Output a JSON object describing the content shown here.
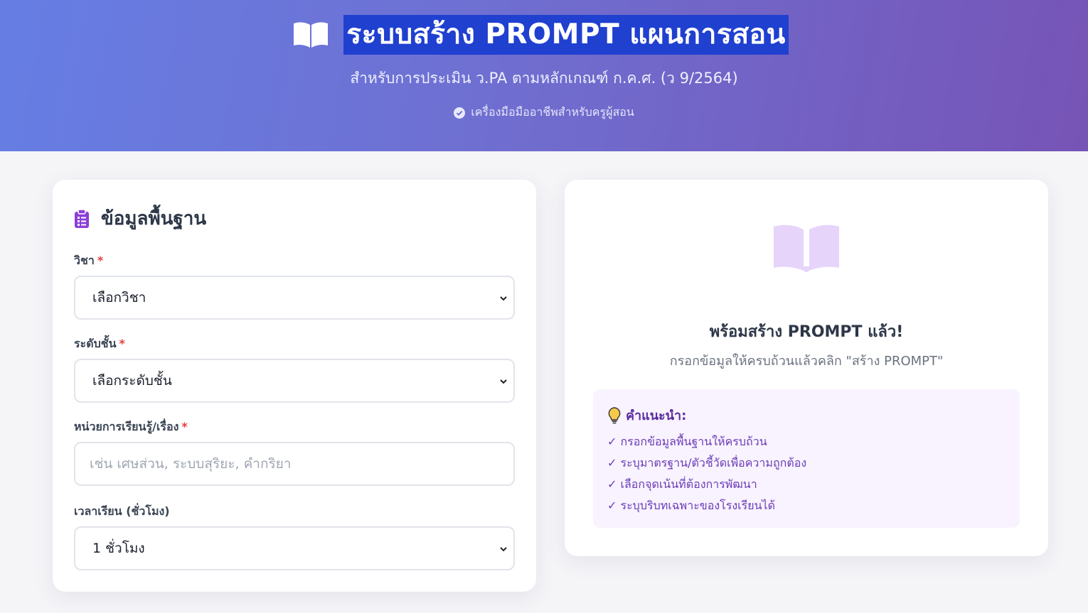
{
  "header": {
    "title": "ระบบสร้าง PROMPT แผนการสอน",
    "subtitle": "สำหรับการประเมิน ว.PA ตามหลักเกณฑ์ ก.ค.ศ. (ว 9/2564)",
    "tagline": "เครื่องมือมืออาชีพสำหรับครูผู้สอน",
    "colors": {
      "gradient_start": "#667ee4",
      "gradient_end": "#7654b6",
      "title_highlight": "#2040d0"
    }
  },
  "form": {
    "heading": "ข้อมูลพื้นฐาน",
    "fields": {
      "subject": {
        "label": "วิชา",
        "required_mark": "*",
        "value": "เลือกวิชา"
      },
      "grade": {
        "label": "ระดับชั้น",
        "required_mark": "*",
        "value": "เลือกระดับชั้น"
      },
      "unit": {
        "label": "หน่วยการเรียนรู้/เรื่อง",
        "required_mark": "*",
        "placeholder": "เช่น เศษส่วน, ระบบสุริยะ, คำกริยา"
      },
      "hours": {
        "label": "เวลาเรียน (ชั่วโมง)",
        "value": "1 ชั่วโมง"
      }
    }
  },
  "preview": {
    "title": "พร้อมสร้าง PROMPT แล้ว!",
    "subtitle": "กรอกข้อมูลให้ครบถ้วนแล้วคลิก \"สร้าง PROMPT\"",
    "tips": {
      "heading": "คำแนะนำ:",
      "items": [
        "✓ กรอกข้อมูลพื้นฐานให้ครบถ้วน",
        "✓ ระบุมาตรฐาน/ตัวชี้วัดเพื่อความถูกต้อง",
        "✓ เลือกจุดเน้นที่ต้องการพัฒนา",
        "✓ ระบุบริบทเฉพาะของโรงเรียนได้"
      ]
    },
    "icons": {
      "book": "open-book-icon",
      "tip": "lightbulb-icon"
    }
  }
}
